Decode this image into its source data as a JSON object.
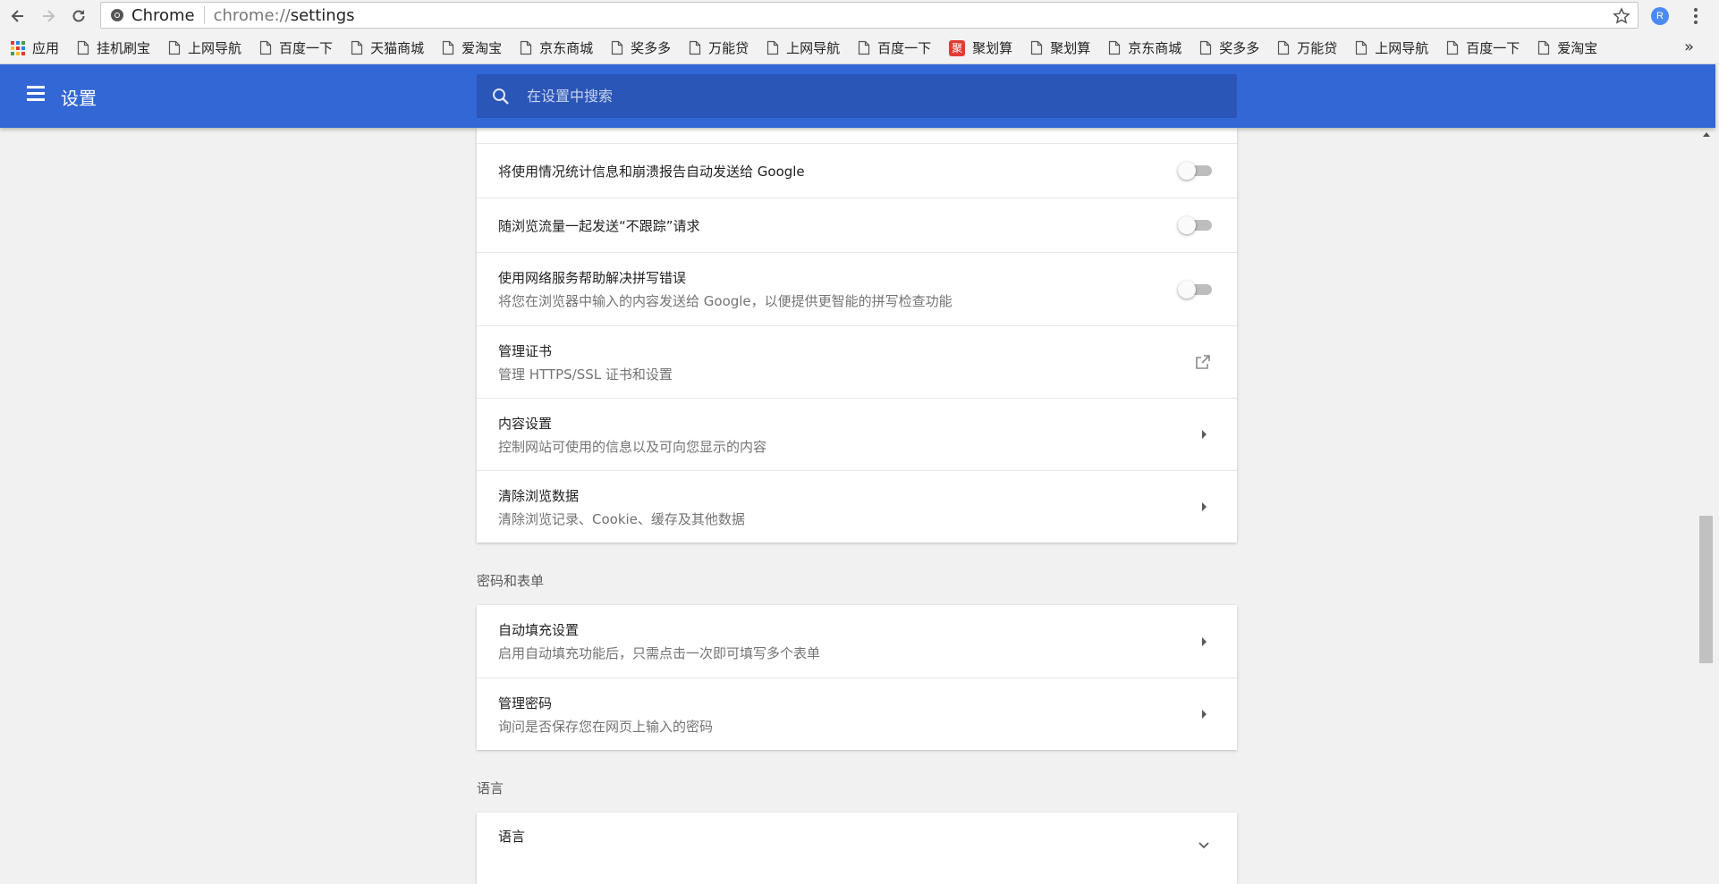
{
  "browser": {
    "omnibox_label": "Chrome",
    "url_scheme": "chrome://",
    "url_path": "settings",
    "extension_badge": "R"
  },
  "bookmarks": [
    {
      "label": "应用",
      "icon": "apps-grid-icon"
    },
    {
      "label": "挂机刷宝",
      "icon": "page-icon"
    },
    {
      "label": "上网导航",
      "icon": "page-icon"
    },
    {
      "label": "百度一下",
      "icon": "page-icon"
    },
    {
      "label": "天猫商城",
      "icon": "page-icon"
    },
    {
      "label": "爱淘宝",
      "icon": "page-icon"
    },
    {
      "label": "京东商城",
      "icon": "page-icon"
    },
    {
      "label": "奖多多",
      "icon": "page-icon"
    },
    {
      "label": "万能贷",
      "icon": "page-icon"
    },
    {
      "label": "上网导航",
      "icon": "page-icon"
    },
    {
      "label": "百度一下",
      "icon": "page-icon"
    },
    {
      "label": "聚划算",
      "icon": "juhuasuan-icon"
    },
    {
      "label": "聚划算",
      "icon": "page-icon"
    },
    {
      "label": "京东商城",
      "icon": "page-icon"
    },
    {
      "label": "奖多多",
      "icon": "page-icon"
    },
    {
      "label": "万能贷",
      "icon": "page-icon"
    },
    {
      "label": "上网导航",
      "icon": "page-icon"
    },
    {
      "label": "百度一下",
      "icon": "page-icon"
    },
    {
      "label": "爱淘宝",
      "icon": "page-icon"
    }
  ],
  "bookmarks_more": "»",
  "juhuasuan_glyph": "聚",
  "header": {
    "title": "设置",
    "search_placeholder": "在设置中搜索"
  },
  "privacy": {
    "usage_stats": {
      "title": "将使用情况统计信息和崩溃报告自动发送给 Google",
      "enabled": false
    },
    "do_not_track": {
      "title": "随浏览流量一起发送“不跟踪”请求",
      "enabled": false
    },
    "spellcheck": {
      "title": "使用网络服务帮助解决拼写错误",
      "subtitle": "将您在浏览器中输入的内容发送给 Google，以便提供更智能的拼写检查功能",
      "enabled": false
    },
    "certificates": {
      "title": "管理证书",
      "subtitle": "管理 HTTPS/SSL 证书和设置"
    },
    "content_settings": {
      "title": "内容设置",
      "subtitle": "控制网站可使用的信息以及可向您显示的内容"
    },
    "clear_data": {
      "title": "清除浏览数据",
      "subtitle": "清除浏览记录、Cookie、缓存及其他数据"
    }
  },
  "passwords": {
    "section_title": "密码和表单",
    "autofill": {
      "title": "自动填充设置",
      "subtitle": "启用自动填充功能后，只需点击一次即可填写多个表单"
    },
    "manage": {
      "title": "管理密码",
      "subtitle": "询问是否保存您在网页上输入的密码"
    }
  },
  "languages": {
    "section_title": "语言",
    "language": {
      "title": "语言"
    }
  },
  "colors": {
    "header": "#3367d6",
    "search": "#2a56b8"
  }
}
